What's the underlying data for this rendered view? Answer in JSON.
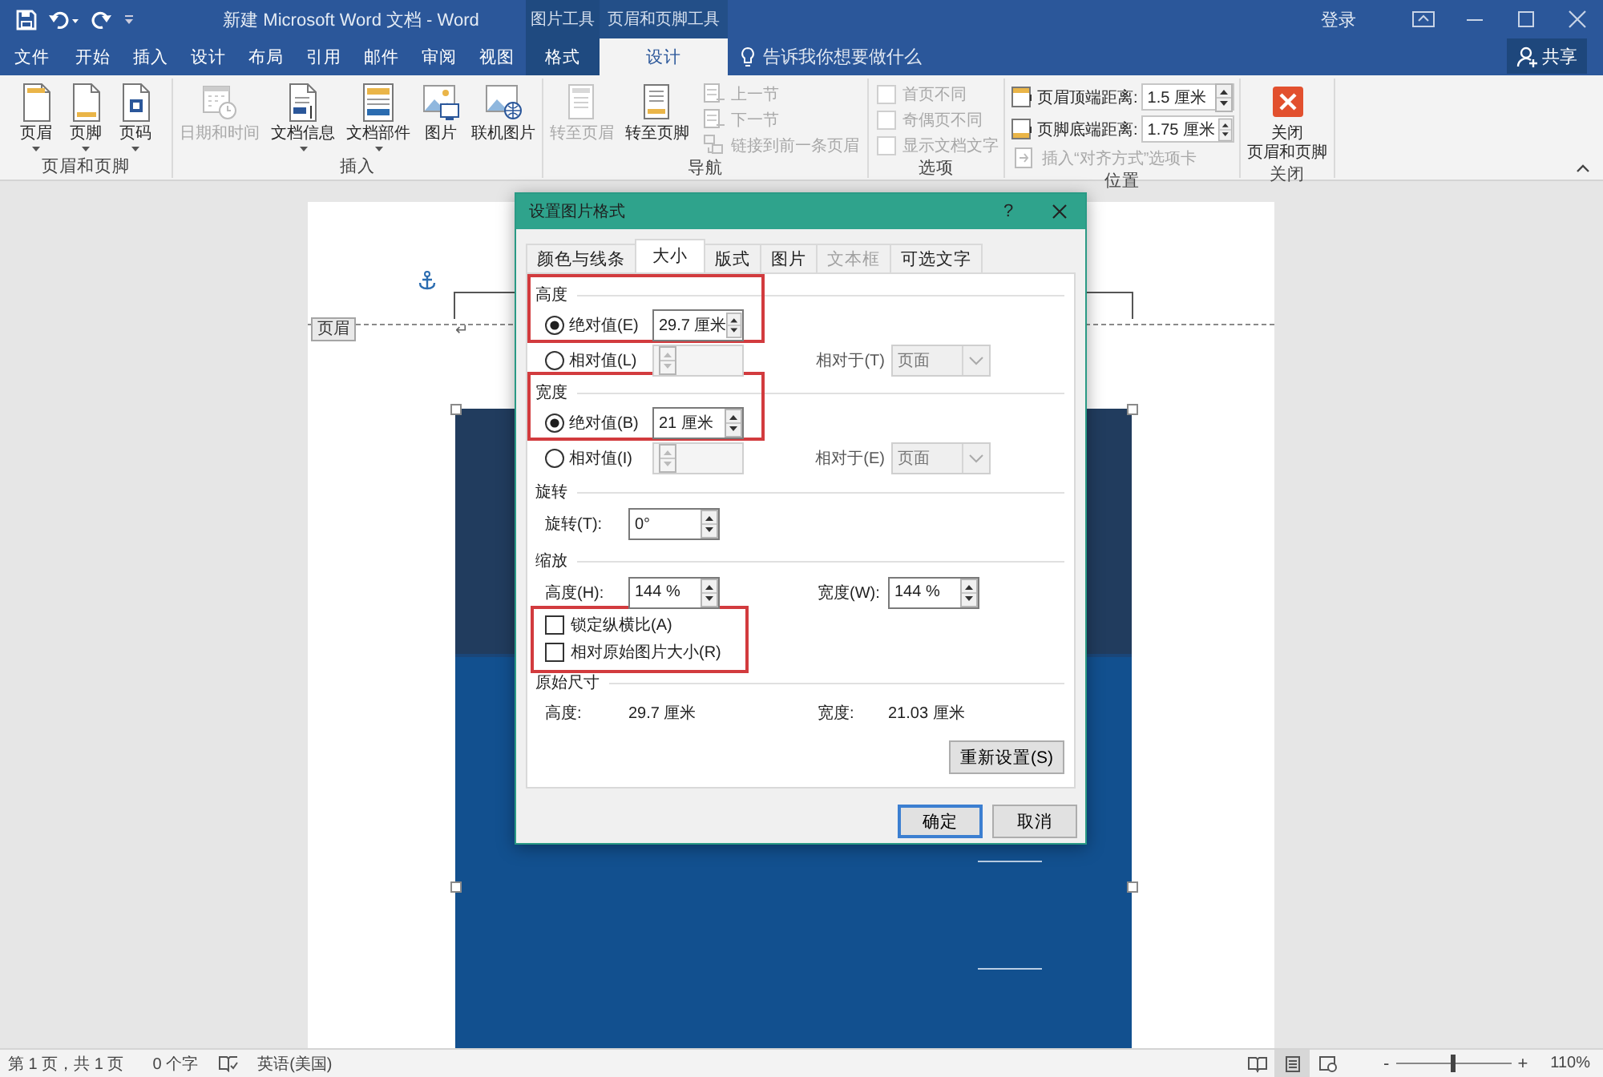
{
  "title_bar": {
    "title": "新建 Microsoft Word 文档 - Word",
    "context_groups": [
      {
        "label": "图片工具"
      },
      {
        "label": "页眉和页脚工具"
      }
    ],
    "sign_in": "登录"
  },
  "tabs": [
    {
      "label": "文件",
      "kind": "normal",
      "selected": false
    },
    {
      "label": "开始",
      "kind": "normal",
      "selected": false
    },
    {
      "label": "插入",
      "kind": "normal",
      "selected": false
    },
    {
      "label": "设计",
      "kind": "normal",
      "selected": false
    },
    {
      "label": "布局",
      "kind": "normal",
      "selected": false
    },
    {
      "label": "引用",
      "kind": "normal",
      "selected": false
    },
    {
      "label": "邮件",
      "kind": "normal",
      "selected": false
    },
    {
      "label": "审阅",
      "kind": "normal",
      "selected": false
    },
    {
      "label": "视图",
      "kind": "normal",
      "selected": false
    },
    {
      "label": "格式",
      "kind": "context",
      "selected": false
    },
    {
      "label": "设计",
      "kind": "context",
      "selected": true
    }
  ],
  "tell_me": "告诉我你想要做什么",
  "share": "共享",
  "ribbon": {
    "groups": [
      {
        "label": "页眉和页脚",
        "items": [
          {
            "kind": "large",
            "label": "页眉",
            "disabled": false,
            "dropdown": true
          },
          {
            "kind": "large",
            "label": "页脚",
            "disabled": false,
            "dropdown": true
          },
          {
            "kind": "large",
            "label": "页码",
            "disabled": false,
            "dropdown": true
          }
        ]
      },
      {
        "label": "插入",
        "items": [
          {
            "kind": "large",
            "label": "日期和时间",
            "disabled": true,
            "dropdown": false
          },
          {
            "kind": "large",
            "label": "文档信息",
            "disabled": false,
            "dropdown": true
          },
          {
            "kind": "large",
            "label": "文档部件",
            "disabled": false,
            "dropdown": true
          },
          {
            "kind": "large",
            "label": "图片",
            "disabled": false,
            "dropdown": false
          },
          {
            "kind": "large",
            "label": "联机图片",
            "disabled": false,
            "dropdown": false
          }
        ]
      },
      {
        "label": "导航",
        "items": [
          {
            "kind": "large",
            "label": "转至页眉",
            "disabled": true,
            "dropdown": false
          },
          {
            "kind": "large",
            "label": "转至页脚",
            "disabled": false,
            "dropdown": false
          },
          {
            "kind": "small",
            "label": "上一节",
            "disabled": true
          },
          {
            "kind": "small",
            "label": "下一节",
            "disabled": true
          },
          {
            "kind": "small",
            "label": "链接到前一条页眉",
            "disabled": true
          }
        ]
      },
      {
        "label": "选项",
        "items": [
          {
            "kind": "checkbox",
            "label": "首页不同",
            "checked": false,
            "disabled": true
          },
          {
            "kind": "checkbox",
            "label": "奇偶页不同",
            "checked": false,
            "disabled": true
          },
          {
            "kind": "checkbox",
            "label": "显示文档文字",
            "checked": false,
            "disabled": true
          }
        ]
      },
      {
        "label": "位置",
        "items": [
          {
            "kind": "spin",
            "label": "页眉顶端距离:",
            "value": "1.5 厘米",
            "disabled": false
          },
          {
            "kind": "spin",
            "label": "页脚底端距离:",
            "value": "1.75 厘米",
            "disabled": false
          },
          {
            "kind": "small",
            "label": "插入“对齐方式”选项卡",
            "disabled": true
          }
        ]
      },
      {
        "label": "关闭",
        "items": [
          {
            "kind": "large",
            "label": "关闭",
            "label_line_2": "页眉和页脚",
            "disabled": false,
            "dropdown": false
          }
        ]
      }
    ]
  },
  "document": {
    "header_tag": "页眉",
    "paragraph_mark": "↵",
    "picture": {
      "kind": "picture",
      "selected": true
    }
  },
  "dialog": {
    "title": "设置图片格式",
    "help": "?",
    "tabs": [
      {
        "label": "颜色与线条",
        "selected": false,
        "disabled": false
      },
      {
        "label": "大小",
        "selected": true,
        "disabled": false
      },
      {
        "label": "版式",
        "selected": false,
        "disabled": false
      },
      {
        "label": "图片",
        "selected": false,
        "disabled": false
      },
      {
        "label": "文本框",
        "selected": false,
        "disabled": true
      },
      {
        "label": "可选文字",
        "selected": false,
        "disabled": false
      }
    ],
    "height": {
      "title": "高度",
      "highlighted": true,
      "absolute": {
        "label": "绝对值(E)",
        "selected": true,
        "value": "29.7 厘米"
      },
      "relative": {
        "label": "相对值(L)",
        "selected": false,
        "disabled": true,
        "relative_to_label": "相对于(T)",
        "relative_to": "页面"
      }
    },
    "width": {
      "title": "宽度",
      "highlighted": true,
      "absolute": {
        "label": "绝对值(B)",
        "selected": true,
        "value": "21 厘米"
      },
      "relative": {
        "label": "相对值(I)",
        "selected": false,
        "disabled": true,
        "relative_to_label": "相对于(E)",
        "relative_to": "页面"
      }
    },
    "rotation": {
      "title": "旋转",
      "label": "旋转(T):",
      "value": "0°"
    },
    "scale": {
      "title": "缩放",
      "height_label": "高度(H):",
      "height_value": "144 %",
      "width_label": "宽度(W):",
      "width_value": "144 %",
      "checkboxes_highlighted": true,
      "checkboxes": [
        {
          "label": "锁定纵横比(A)",
          "checked": false
        },
        {
          "label": "相对原始图片大小(R)",
          "checked": false
        }
      ]
    },
    "original_size": {
      "title": "原始尺寸",
      "height_label": "高度:",
      "height_value": "29.7 厘米",
      "width_label": "宽度:",
      "width_value": "21.03 厘米",
      "reset_button": "重新设置(S)"
    },
    "buttons": [
      {
        "label": "确定",
        "default": true
      },
      {
        "label": "取消",
        "default": false
      }
    ]
  },
  "status_bar": {
    "page": "第 1 页，共 1 页",
    "words": "0 个字",
    "language": "英语(美国)",
    "views": [
      {
        "selected": false
      },
      {
        "selected": true
      },
      {
        "selected": false
      }
    ],
    "zoom_out": "-",
    "zoom_in": "+",
    "zoom": {
      "level": 0.5
    },
    "zoom_percent": "110%"
  }
}
